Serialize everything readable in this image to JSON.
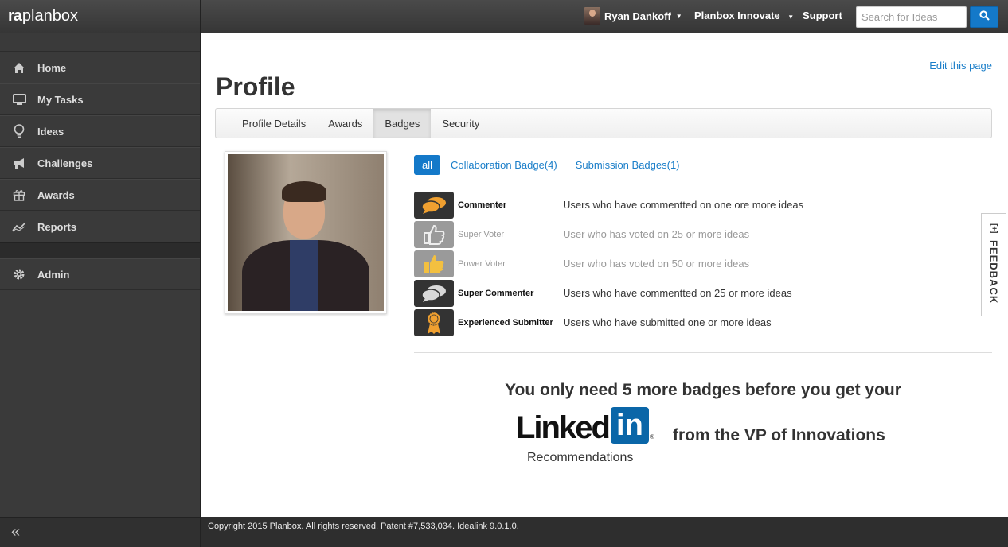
{
  "app": {
    "logo_text": "planbox",
    "logo_mark": "ra"
  },
  "sidebar": {
    "items": [
      {
        "label": "Home",
        "icon": "home-icon"
      },
      {
        "label": "My Tasks",
        "icon": "monitor-icon"
      },
      {
        "label": "Ideas",
        "icon": "lightbulb-icon"
      },
      {
        "label": "Challenges",
        "icon": "megaphone-icon"
      },
      {
        "label": "Awards",
        "icon": "gift-icon"
      },
      {
        "label": "Reports",
        "icon": "chart-line-icon"
      }
    ],
    "admin": {
      "label": "Admin",
      "icon": "gear-icon"
    },
    "collapse": "«"
  },
  "topbar": {
    "user_name": "Ryan Dankoff",
    "innovate_menu": "Planbox Innovate",
    "support": "Support",
    "search_placeholder": "Search for Ideas"
  },
  "main": {
    "edit_link": "Edit this page",
    "title": "Profile",
    "tabs": [
      {
        "label": "Profile Details",
        "active": false
      },
      {
        "label": "Awards",
        "active": false
      },
      {
        "label": "Badges",
        "active": true
      },
      {
        "label": "Security",
        "active": false
      }
    ],
    "filters": {
      "all": "all",
      "collaboration": "Collaboration Badge(4)",
      "submission": "Submission Badges(1)"
    },
    "badges": [
      {
        "name": "Commenter",
        "desc": "Users who have commentted on one ore more ideas",
        "earned": true,
        "icon": "comment-bubbles-icon",
        "color": "#333333",
        "accent": "#f0a030"
      },
      {
        "name": "Super Voter",
        "desc": "User who has voted on 25 or more ideas",
        "earned": false,
        "icon": "thumbs-up-icon",
        "color": "#9a9a9a",
        "accent": "#e6e6e6"
      },
      {
        "name": "Power Voter",
        "desc": "User who has voted on 50 or more ideas",
        "earned": false,
        "icon": "thumbs-up-icon",
        "color": "#9a9a9a",
        "accent": "#f3c040"
      },
      {
        "name": "Super Commenter",
        "desc": "Users who have commentted on 25 or more ideas",
        "earned": true,
        "icon": "comment-bubbles-icon",
        "color": "#333333",
        "accent": "#d8d8d8"
      },
      {
        "name": "Experienced Submitter",
        "desc": "Users who have submitted one or more ideas",
        "earned": true,
        "icon": "ribbon-award-icon",
        "color": "#333333",
        "accent": "#f0a030"
      }
    ],
    "promo": {
      "line1": "You only need 5 more badges before you get your",
      "linkedin_word": "Linked",
      "linkedin_box": "in",
      "linkedin_reg": "®",
      "linkedin_sub": "Recommendations",
      "line2": "from the VP of Innovations"
    }
  },
  "feedback": {
    "label": "FEEDBACK",
    "icon_glyph": "[+]"
  },
  "footer": {
    "text": "Copyright 2015 Planbox. All rights reserved. Patent #7,533,034. Idealink 9.0.1.0."
  }
}
